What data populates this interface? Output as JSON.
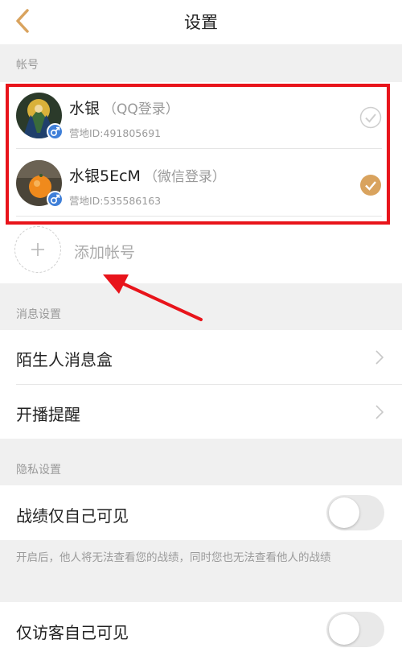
{
  "header": {
    "title": "设置"
  },
  "accounts_section": {
    "label": "帐号",
    "accounts": [
      {
        "name": "水银",
        "login": "（QQ登录）",
        "id_text": "营地ID:491805691",
        "selected": false
      },
      {
        "name": "水银5EcM",
        "login": "（微信登录）",
        "id_text": "营地ID:535586163",
        "selected": true
      }
    ],
    "add_label": "添加帐号"
  },
  "message_section": {
    "label": "消息设置",
    "items": [
      {
        "label": "陌生人消息盒"
      },
      {
        "label": "开播提醒"
      }
    ]
  },
  "privacy_section": {
    "label": "隐私设置",
    "items": [
      {
        "label": "战绩仅自己可见",
        "on": false
      },
      {
        "label": "仅访客自己可见",
        "on": false
      }
    ],
    "note": "开启后，他人将无法查看您的战绩，同时您也无法查看他人的战绩"
  },
  "colors": {
    "accent": "#d9a35e",
    "highlight": "#e8141b",
    "gender": "#3f7fd8"
  }
}
